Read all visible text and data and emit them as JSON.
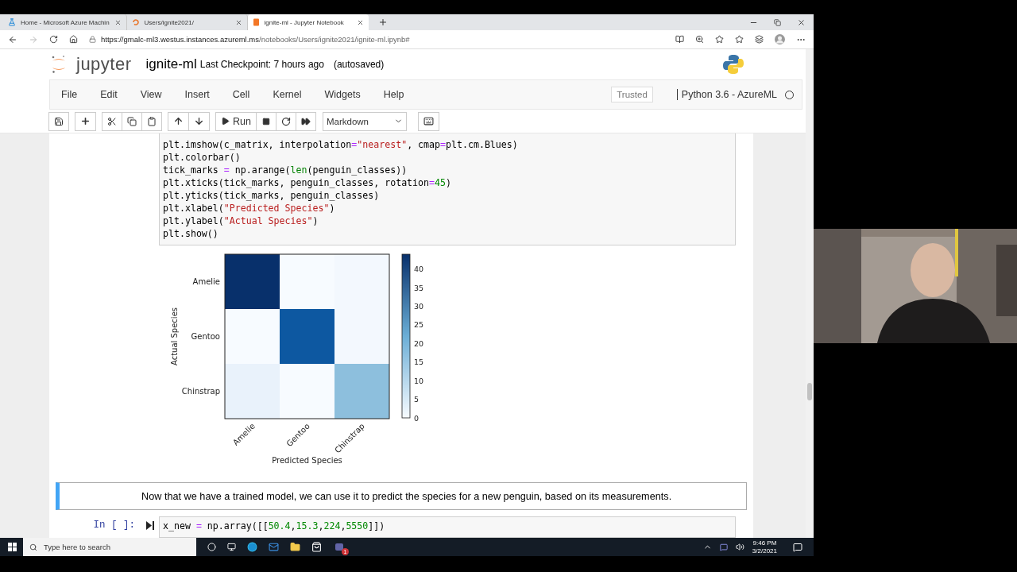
{
  "browser": {
    "tabs": [
      {
        "kind": "flask",
        "title": "Home - Microsoft Azure Machin",
        "selected": false
      },
      {
        "kind": "spinner",
        "title": "Users/ignite2021/",
        "selected": false
      },
      {
        "kind": "notebook",
        "title": "ignite-ml - Jupyter Notebook",
        "selected": true
      }
    ],
    "url": {
      "host": "https://gmalc-ml3.westus.instances.azureml.ms",
      "path": "/notebooks/Users/ignite2021/ignite-ml.ipynb#"
    }
  },
  "notebook": {
    "logo": "jupyter",
    "name": "ignite-ml",
    "checkpoint": "Last Checkpoint: 7 hours ago",
    "save_status": "(autosaved)"
  },
  "menu": [
    "File",
    "Edit",
    "View",
    "Insert",
    "Cell",
    "Kernel",
    "Widgets",
    "Help"
  ],
  "trusted": "Trusted",
  "kernel": {
    "name": "Python 3.6 - AzureML",
    "busy": false
  },
  "toolbar": {
    "run": "Run",
    "cell_type": "Markdown"
  },
  "cells": [
    {
      "kind": "code",
      "selected": false,
      "lines": [
        [
          {
            "t": "plt.imshow(c_matrix, interpolation",
            "kind": "plain"
          },
          {
            "t": "=",
            "kind": "op"
          },
          {
            "t": "\"nearest\"",
            "kind": "string"
          },
          {
            "t": ", cmap",
            "kind": "plain"
          },
          {
            "t": "=",
            "kind": "op"
          },
          {
            "t": "plt.cm.Blues)",
            "kind": "plain"
          }
        ],
        [
          {
            "t": "plt.colorbar()",
            "kind": "plain"
          }
        ],
        [
          {
            "t": "tick_marks ",
            "kind": "plain"
          },
          {
            "t": "=",
            "kind": "op"
          },
          {
            "t": " np.arange(",
            "kind": "plain"
          },
          {
            "t": "len",
            "kind": "builtin"
          },
          {
            "t": "(penguin_classes))",
            "kind": "plain"
          }
        ],
        [
          {
            "t": "plt.xticks(tick_marks, penguin_classes, rotation",
            "kind": "plain"
          },
          {
            "t": "=",
            "kind": "op"
          },
          {
            "t": "45",
            "kind": "number"
          },
          {
            "t": ")",
            "kind": "plain"
          }
        ],
        [
          {
            "t": "plt.yticks(tick_marks, penguin_classes)",
            "kind": "plain"
          }
        ],
        [
          {
            "t": "plt.xlabel(",
            "kind": "plain"
          },
          {
            "t": "\"Predicted Species\"",
            "kind": "string"
          },
          {
            "t": ")",
            "kind": "plain"
          }
        ],
        [
          {
            "t": "plt.ylabel(",
            "kind": "plain"
          },
          {
            "t": "\"Actual Species\"",
            "kind": "string"
          },
          {
            "t": ")",
            "kind": "plain"
          }
        ],
        [
          {
            "t": "plt.show()",
            "kind": "plain"
          }
        ]
      ]
    },
    {
      "kind": "heatmap",
      "row_labels": [
        "Amelie",
        "Gentoo",
        "Chinstrap"
      ],
      "column_labels": [
        "Amelie",
        "Gentoo",
        "Chinstrap"
      ],
      "cells": [
        [
          {
            "color": "#08306b"
          },
          {
            "color": "#f7fbff"
          },
          {
            "color": "#f3f8fe"
          }
        ],
        [
          {
            "color": "#f7fbff"
          },
          {
            "color": "#0d58a1"
          },
          {
            "color": "#f3f8fe"
          }
        ],
        [
          {
            "color": "#e9f2fb"
          },
          {
            "color": "#f7fbff"
          },
          {
            "color": "#8dbfdd"
          }
        ]
      ],
      "colorbar_ticks": [
        "40",
        "35",
        "30",
        "25",
        "20",
        "15",
        "10",
        "5",
        "0"
      ],
      "xlabel": "Predicted Species",
      "ylabel": "Actual Species"
    },
    {
      "kind": "markdown",
      "selected": true,
      "text": "Now that we have a trained model, we can use it to predict the species for a new penguin, based on its measurements."
    },
    {
      "kind": "code",
      "selected": false,
      "prompt": "In [ ]:",
      "lines": [
        [
          {
            "t": "x_new ",
            "kind": "plain"
          },
          {
            "t": "=",
            "kind": "op"
          },
          {
            "t": " np.array([[",
            "kind": "plain"
          },
          {
            "t": "50.4",
            "kind": "number"
          },
          {
            "t": ",",
            "kind": "plain"
          },
          {
            "t": "15.3",
            "kind": "number"
          },
          {
            "t": ",",
            "kind": "plain"
          },
          {
            "t": "224",
            "kind": "number"
          },
          {
            "t": ",",
            "kind": "plain"
          },
          {
            "t": "5550",
            "kind": "number"
          },
          {
            "t": "]])",
            "kind": "plain"
          }
        ]
      ]
    }
  ],
  "taskbar": {
    "search_placeholder": "Type here to search",
    "teams_badge": "1",
    "time": "9:46 PM",
    "date": "3/2/2021"
  },
  "webcam": {
    "kind": "picture"
  }
}
